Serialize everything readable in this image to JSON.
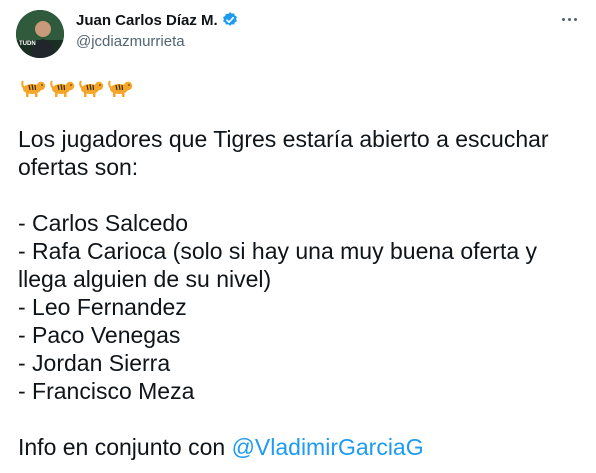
{
  "author": {
    "display_name": "Juan Carlos Díaz M.",
    "handle": "@jcdiazmurrieta",
    "verified": true,
    "avatar_badge": "TUDN"
  },
  "tweet": {
    "emoji_row": [
      "tiger-icon",
      "tiger-icon",
      "tiger-icon",
      "tiger-icon"
    ],
    "intro_line1": "Los jugadores que Tigres estaría abierto a escuchar",
    "intro_line2": "ofertas son:",
    "players": [
      "- Carlos Salcedo",
      "- Rafa Carioca (solo si hay una muy buena oferta y",
      "llega alguien de su nivel)",
      "- Leo Fernandez",
      "- Paco Venegas",
      "- Jordan Sierra",
      "- Francisco Meza"
    ],
    "footer_prefix": "Info en conjunto con ",
    "mention": "@VladimirGarciaG"
  },
  "colors": {
    "link": "#1d9bf0",
    "secondary_text": "#536471",
    "verified": "#1d9bf0"
  }
}
